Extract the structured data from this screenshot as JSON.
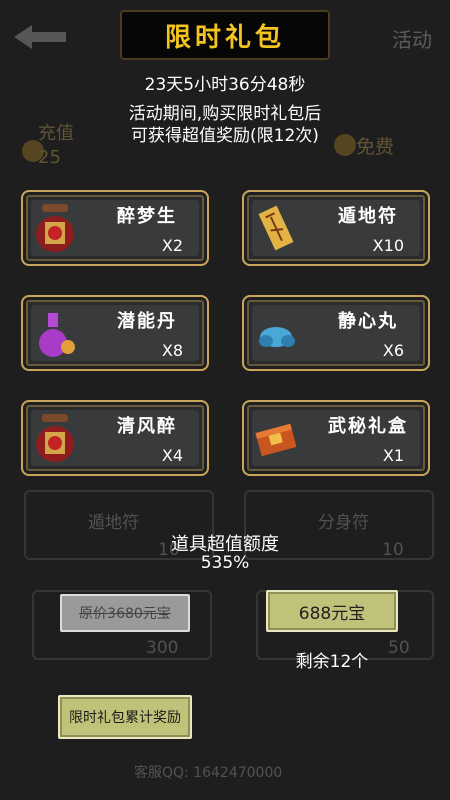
{
  "background": {
    "activity_label": "活动",
    "recharge_label": "充值",
    "recharge_value": "25",
    "free_label": "免费",
    "row1_left_name": "遁地符",
    "row1_left_value": "10",
    "row1_right_name": "分身符",
    "row1_right_value": "10",
    "price_left_value": "300",
    "price_right_value": "50",
    "service_qq": "客服QQ: 1642470000"
  },
  "header": {
    "title": "限时礼包",
    "countdown": "23天5小时36分48秒",
    "desc_line1": "活动期间,购买限时礼包后",
    "desc_line2": "可获得超值奖励(限12次)"
  },
  "items": [
    {
      "name": "醉梦生",
      "qty": "X2",
      "icon": "wine-jar-icon"
    },
    {
      "name": "遁地符",
      "qty": "X10",
      "icon": "talisman-icon"
    },
    {
      "name": "潜能丹",
      "qty": "X8",
      "icon": "potion-flask-icon"
    },
    {
      "name": "静心丸",
      "qty": "X6",
      "icon": "blue-pill-icon"
    },
    {
      "name": "清风醉",
      "qty": "X4",
      "icon": "wine-jar-icon"
    },
    {
      "name": "武秘礼盒",
      "qty": "X1",
      "icon": "gift-box-icon"
    }
  ],
  "value": {
    "label": "道具超值额度",
    "percent": "535%"
  },
  "purchase": {
    "original_price": "原价3680元宝",
    "price_button": "688元宝",
    "remaining": "剩余12个",
    "reward_button": "限时礼包累计奖励"
  },
  "colors": {
    "title_gold": "#f3c320",
    "card_border": "#c8a55a",
    "button_bg": "#c1c27a"
  }
}
